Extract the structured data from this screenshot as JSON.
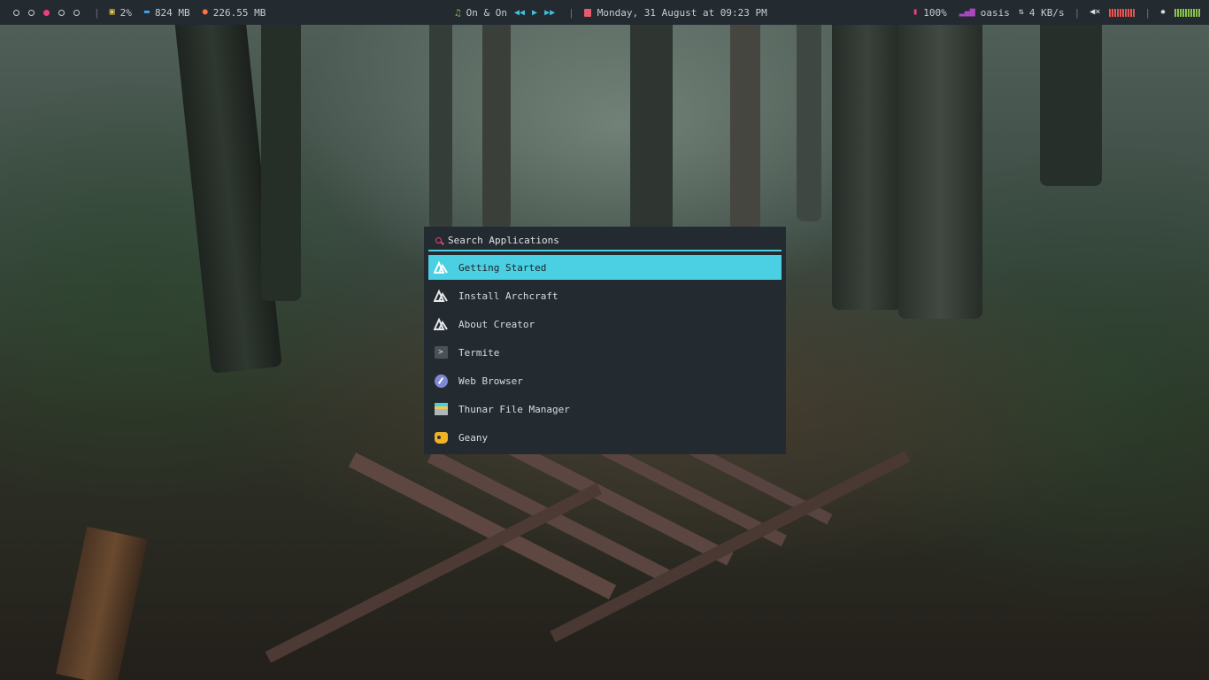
{
  "topbar": {
    "workspaces": [
      {
        "active": false
      },
      {
        "active": false
      },
      {
        "active": true
      },
      {
        "active": false
      },
      {
        "active": false
      }
    ],
    "cpu": {
      "icon": "cpu-icon",
      "value": "2%"
    },
    "memory": {
      "icon": "memory-icon",
      "value": "824 MB"
    },
    "disk": {
      "icon": "disk-icon",
      "value": "226.55 MB"
    },
    "music": {
      "icon": "music-note-icon",
      "title": "On & On"
    },
    "datetime": {
      "icon": "calendar-icon",
      "value": "Monday, 31 August at 09:23 PM"
    },
    "battery": {
      "icon": "battery-icon",
      "value": "100%"
    },
    "network": {
      "icon": "wifi-signal-icon",
      "ssid": "oasis",
      "speed": "4 KB/s"
    },
    "volume": {
      "icon": "volume-muted-icon"
    },
    "brightness": {
      "icon": "brightness-icon"
    },
    "colors": {
      "bar_bg": "#232a30",
      "accent": "#4bcfe3",
      "pink": "#ec407a"
    }
  },
  "launcher": {
    "search": {
      "placeholder": "Search Applications"
    },
    "items": [
      {
        "label": "Getting Started",
        "icon": "archcraft-logo-icon",
        "selected": true
      },
      {
        "label": "Install Archcraft",
        "icon": "archcraft-logo-icon"
      },
      {
        "label": "About Creator",
        "icon": "archcraft-logo-icon"
      },
      {
        "label": "Termite",
        "icon": "terminal-icon"
      },
      {
        "label": "Web Browser",
        "icon": "web-browser-icon"
      },
      {
        "label": "Thunar File Manager",
        "icon": "file-manager-icon"
      },
      {
        "label": "Geany",
        "icon": "geany-icon"
      }
    ]
  }
}
